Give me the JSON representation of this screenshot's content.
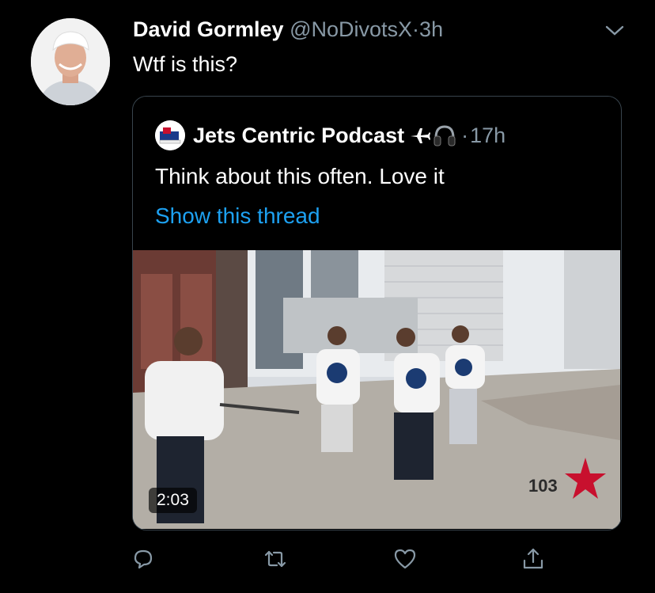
{
  "tweet": {
    "author_name": "David Gormley",
    "author_handle": "@NoDivotsX",
    "separator": "·",
    "time": "3h",
    "text": "Wtf is this?"
  },
  "quoted": {
    "author_name": "Jets Centric Podcast",
    "name_emoji": [
      "airplane-icon",
      "headphones-icon"
    ],
    "separator": "·",
    "time": "17h",
    "text": "Think about this often. Love it",
    "thread_link": "Show this thread",
    "video": {
      "duration": "2:03",
      "overlay_brand": "103",
      "scene": "outdoor-street-hockey-dancers"
    }
  },
  "actions": {
    "icons": [
      "reply-icon",
      "retweet-icon",
      "like-icon",
      "share-icon"
    ]
  },
  "colors": {
    "background": "#000000",
    "secondary_text": "#8899a6",
    "link": "#1da1f2",
    "border": "#38444d"
  }
}
